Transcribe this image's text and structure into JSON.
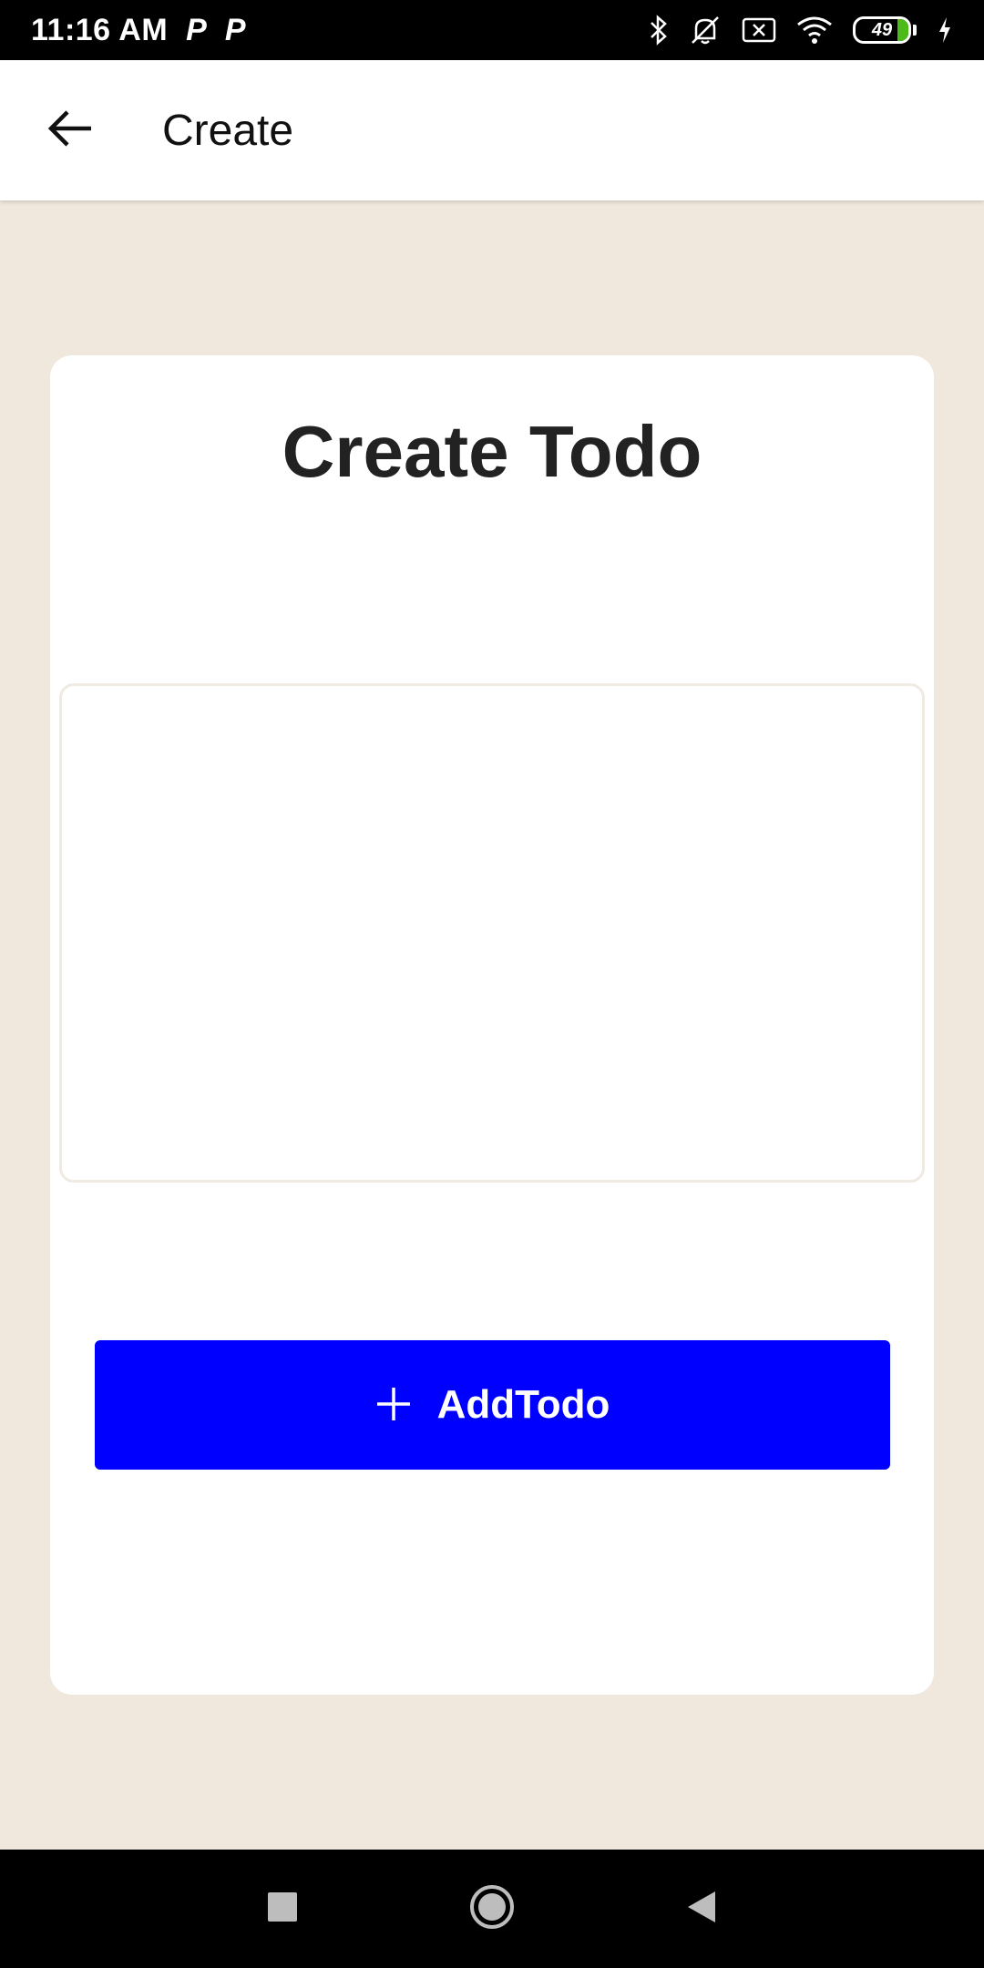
{
  "status_bar": {
    "time": "11:16 AM",
    "notif_icons": [
      "P",
      "P"
    ],
    "battery_level": "49",
    "battery_fill_color": "#4cbb17"
  },
  "app_bar": {
    "title": "Create",
    "back_icon": "arrow-left-icon"
  },
  "card": {
    "heading": "Create Todo",
    "input_value": "",
    "input_placeholder": "",
    "add_button": {
      "label": "AddTodo",
      "icon": "plus-icon",
      "color": "#0000ff"
    }
  },
  "nav_bar": {
    "buttons": [
      "recents-icon",
      "home-icon",
      "back-icon"
    ]
  },
  "colors": {
    "background": "#f1e8dd",
    "card": "#ffffff",
    "accent": "#0000ff"
  }
}
